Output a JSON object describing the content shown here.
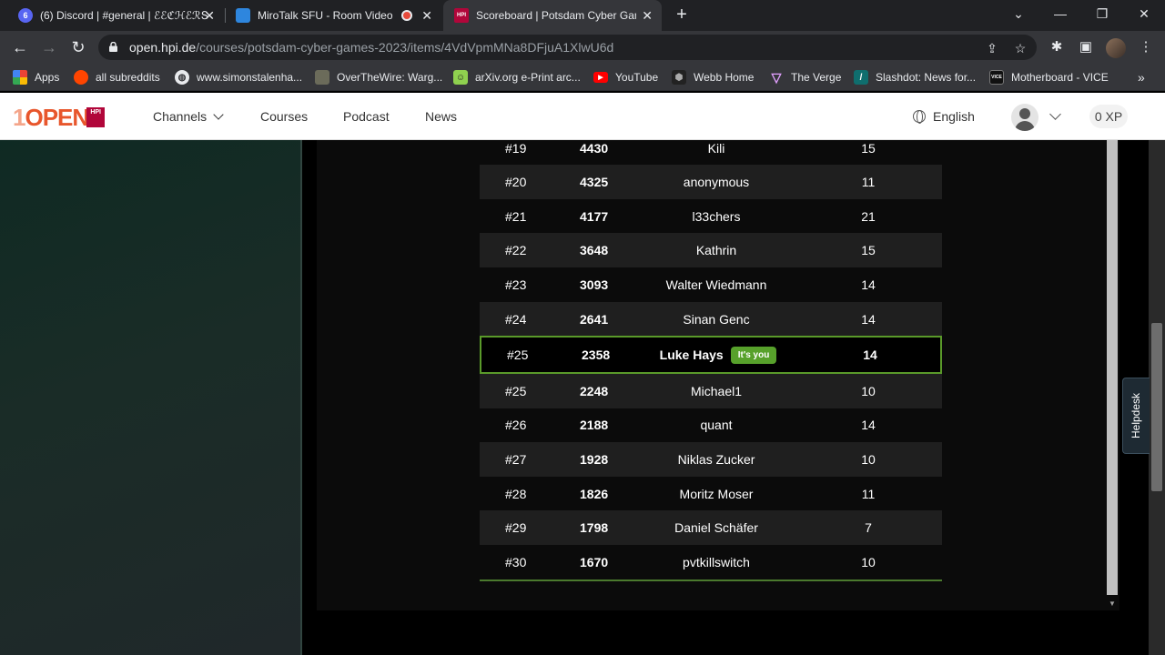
{
  "browser": {
    "tabs": [
      {
        "title": "(6) Discord | #general | ℰℰℭℋℰℛՏ",
        "favicon": "discord-icon",
        "badge": "6"
      },
      {
        "title": "MiroTalk SFU - Room Video C",
        "favicon": "mirotalk-icon"
      },
      {
        "title": "Scoreboard | Potsdam Cyber Gam",
        "favicon": "hpi-icon"
      }
    ],
    "url_host": "open.hpi.de",
    "url_path": "/courses/potsdam-cyber-games-2023/items/4VdVpmMNa8DFjuA1XlwU6d",
    "bookmarks": [
      {
        "label": "Apps",
        "icon": "apps-grid-icon"
      },
      {
        "label": "all subreddits",
        "icon": "reddit-icon"
      },
      {
        "label": "www.simonstalenha...",
        "icon": "globe-icon"
      },
      {
        "label": "OverTheWire: Warg...",
        "icon": "overthewire-icon"
      },
      {
        "label": "arXiv.org e-Print arc...",
        "icon": "arxiv-icon"
      },
      {
        "label": "YouTube",
        "icon": "youtube-icon"
      },
      {
        "label": "Webb Home",
        "icon": "webb-icon"
      },
      {
        "label": "The Verge",
        "icon": "verge-icon"
      },
      {
        "label": "Slashdot: News for...",
        "icon": "slashdot-icon"
      },
      {
        "label": "Motherboard - VICE",
        "icon": "vice-icon"
      }
    ]
  },
  "site": {
    "logo_num": "1",
    "logo_word": "OPEN",
    "logo_hpi": "HPI",
    "nav": {
      "channels": "Channels",
      "courses": "Courses",
      "podcast": "Podcast",
      "news": "News"
    },
    "language": "English",
    "xp": "0 XP"
  },
  "scoreboard": {
    "rows": [
      {
        "rank": "#19",
        "points": "4430",
        "name": "Kili",
        "solves": "15"
      },
      {
        "rank": "#20",
        "points": "4325",
        "name": "anonymous",
        "solves": "11"
      },
      {
        "rank": "#21",
        "points": "4177",
        "name": "l33chers",
        "solves": "21"
      },
      {
        "rank": "#22",
        "points": "3648",
        "name": "Kathrin",
        "solves": "15"
      },
      {
        "rank": "#23",
        "points": "3093",
        "name": "Walter Wiedmann",
        "solves": "14"
      },
      {
        "rank": "#24",
        "points": "2641",
        "name": "Sinan Genc",
        "solves": "14"
      },
      {
        "rank": "#25",
        "points": "2358",
        "name": "Luke Hays",
        "solves": "14",
        "me": true,
        "badge": "It's you"
      },
      {
        "rank": "#25",
        "points": "2248",
        "name": "Michael1",
        "solves": "10"
      },
      {
        "rank": "#26",
        "points": "2188",
        "name": "quant",
        "solves": "14"
      },
      {
        "rank": "#27",
        "points": "1928",
        "name": "Niklas Zucker",
        "solves": "10"
      },
      {
        "rank": "#28",
        "points": "1826",
        "name": "Moritz Moser",
        "solves": "11"
      },
      {
        "rank": "#29",
        "points": "1798",
        "name": "Daniel Schäfer",
        "solves": "7"
      },
      {
        "rank": "#30",
        "points": "1670",
        "name": "pvtkillswitch",
        "solves": "10"
      }
    ]
  },
  "helpdesk": "Helpdesk",
  "colors": {
    "accent_green": "#57a12b",
    "row_alt": "#1f1f1f",
    "brand_orange": "#e8562c"
  }
}
